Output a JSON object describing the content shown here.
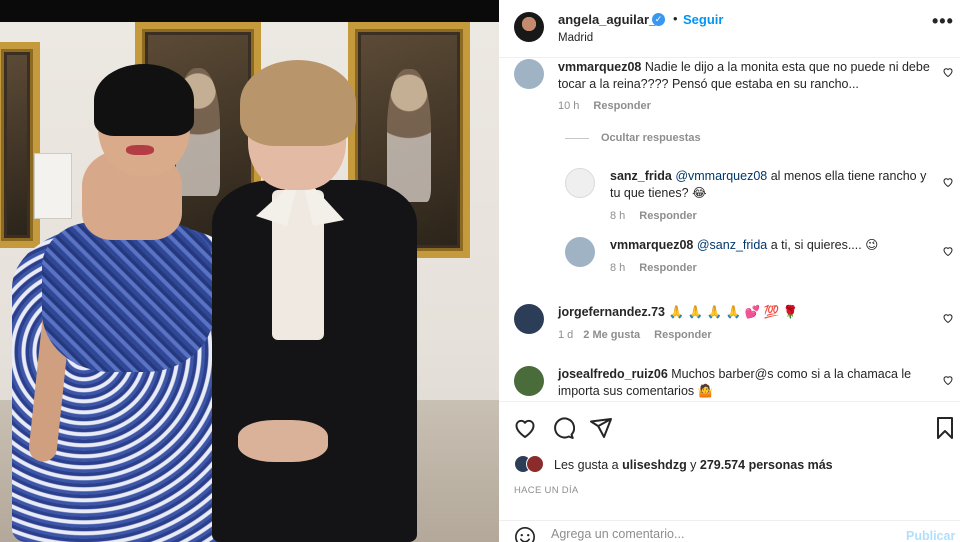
{
  "post": {
    "username": "angela_aguilar_",
    "verified_glyph": "✓",
    "dot": "•",
    "follow_label": "Seguir",
    "location": "Madrid",
    "more_glyph": "•••"
  },
  "comments": [
    {
      "username": "vmmarquez08",
      "text": "Nadie le dijo a la monita esta que no puede ni debe tocar a la reina???? Pensó que estaba en su rancho...",
      "time": "10 h",
      "reply_label": "Responder",
      "avatar_color": "#9fb3c4"
    },
    {
      "hide_replies_label": "Ocultar respuestas"
    },
    {
      "username": "sanz_frida",
      "mention": "@vmmarquez08",
      "text": " al menos ella tiene rancho y tu que tienes? 😂",
      "time": "8 h",
      "reply_label": "Responder",
      "avatar_color": "#efefef"
    },
    {
      "username": "vmmarquez08",
      "mention": "@sanz_frida",
      "text": " a ti, si quieres.... 😉",
      "time": "8 h",
      "reply_label": "Responder",
      "avatar_color": "#9fb3c4"
    },
    {
      "username": "jorgefernandez.73",
      "text": " 🙏 🙏 🙏 🙏 💕 💯 🌹",
      "time": "1 d",
      "likes": "2 Me gusta",
      "reply_label": "Responder",
      "avatar_color": "#2c3e57"
    },
    {
      "username": "josealfredo_ruiz06",
      "text": " Muchos barber@s como si a la chamaca le importa sus comentarios 🤷",
      "avatar_color": "#4a6b3a"
    }
  ],
  "actions": {
    "likes_prefix": "Les gusta a ",
    "likes_user": "uliseshdzg",
    "likes_middle": " y ",
    "likes_count": "279.574 personas más",
    "time_ago": "HACE UN DÍA",
    "comment_placeholder": "Agrega un comentario...",
    "publish_label": "Publicar"
  },
  "colors": {
    "accent": "#0095f6",
    "publish_disabled": "#b2dffc",
    "muted": "#8e8e8e"
  },
  "icons": [
    "verified-badge-icon",
    "more-options-icon",
    "heart-icon",
    "comment-icon",
    "share-icon",
    "bookmark-icon",
    "emoji-icon"
  ]
}
